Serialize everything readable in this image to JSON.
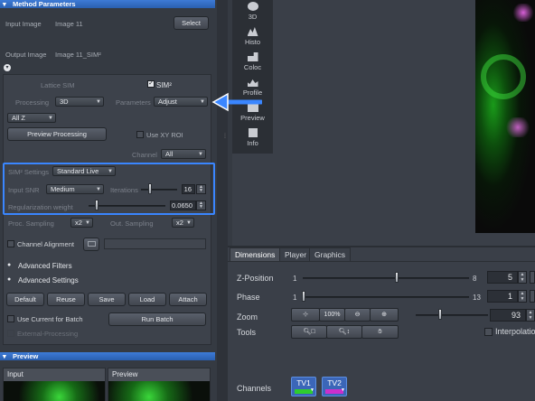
{
  "method": {
    "header": "Method Parameters",
    "input_label": "Input Image",
    "input_value": "Image 11",
    "select_label": "Select",
    "output_label": "Output Image",
    "output_value": "Image 11_SIM²",
    "lattice_label": "Lattice SIM",
    "sim_label": "SIM²",
    "processing_label": "Processing",
    "processing_value": "3D",
    "parameters_label": "Parameters",
    "parameters_value": "Adjust",
    "z_value": "All Z",
    "preview_processing": "Preview Processing",
    "use_xy_roi": "Use XY ROI",
    "channel_label": "Channel",
    "channel_value": "All",
    "sim2_settings_label": "SIM² Settings",
    "sim2_settings_value": "Standard Live",
    "input_snr_label": "Input SNR",
    "input_snr_value": "Medium",
    "iterations_label": "Iterations",
    "iterations_value": "16",
    "reg_weight_label": "Regularization weight",
    "reg_weight_value": "0.0650",
    "proc_sampling_label": "Proc. Sampling",
    "proc_sampling_value": "x2",
    "out_sampling_label": "Out. Sampling",
    "out_sampling_value": "x2",
    "channel_alignment": "Channel Alignment",
    "advanced_filters": "Advanced Filters",
    "advanced_settings": "Advanced Settings",
    "buttons": {
      "default": "Default",
      "reuse": "Reuse",
      "save": "Save",
      "load": "Load",
      "attach": "Attach"
    },
    "use_current_batch": "Use Current for Batch",
    "run_batch": "Run Batch",
    "external_processing": "External-Processing"
  },
  "preview": {
    "header": "Preview",
    "input_tab": "Input",
    "preview_tab": "Preview"
  },
  "vtabs": [
    "3D",
    "Histo",
    "Coloc",
    "Profile",
    "Preview",
    "Info"
  ],
  "tabs": [
    "Dimensions",
    "Player",
    "Graphics"
  ],
  "dimensions": {
    "zpos_label": "Z-Position",
    "zpos_min": "1",
    "zpos_max": "8",
    "zpos_value": "5",
    "phase_label": "Phase",
    "phase_min": "1",
    "phase_max": "13",
    "phase_value": "1",
    "zoom_label": "Zoom",
    "zoom_100": "100%",
    "zoom_value": "93",
    "tools_label": "Tools",
    "interpolation": "Interpolation",
    "channels_label": "Channels",
    "tv1": "TV1",
    "tv2": "TV2"
  },
  "colors": {
    "accent_blue": "#3d7bd6",
    "highlight": "#3a86ff",
    "tv1": "#2fcc2f",
    "tv2": "#cc2fcc"
  }
}
